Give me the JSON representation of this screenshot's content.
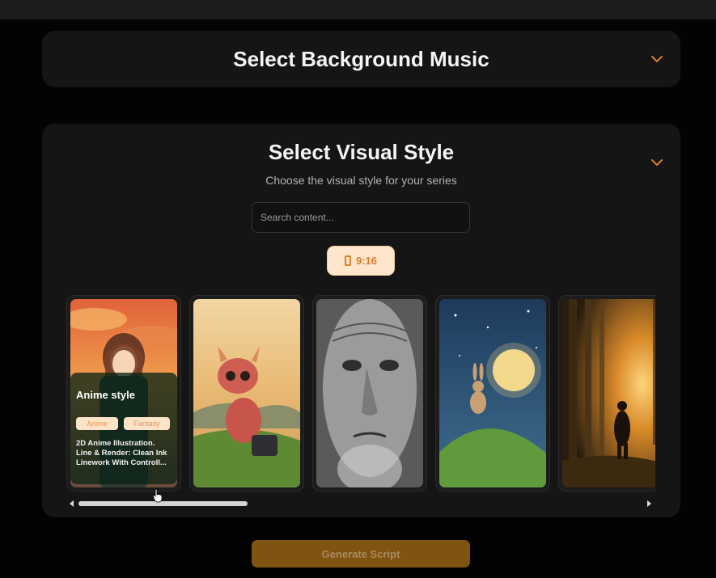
{
  "music_section": {
    "title": "Select Background Music"
  },
  "style_section": {
    "title": "Select Visual Style",
    "subtitle": "Choose the visual style for your  series",
    "search": {
      "placeholder": "Search content..."
    },
    "aspect_ratio": {
      "label": "9:16",
      "icon": "phone-icon"
    },
    "cards": [
      {
        "art": "anime-girl-sunset",
        "title": "Anime style",
        "tags": [
          "Anime",
          "Fantasy"
        ],
        "description": "2D Anime Illustration. Line & Render: Clean Ink Linework With Controll..."
      },
      {
        "art": "cartoon-dragon"
      },
      {
        "art": "pencil-portrait-old-man"
      },
      {
        "art": "rabbit-moon-hill"
      },
      {
        "art": "forest-sunset-samurai"
      }
    ]
  },
  "generate_button": {
    "label": "Generate Script"
  },
  "colors": {
    "accent": "#d8802a",
    "panel": "#151515",
    "background": "#030303",
    "button": "#7f5411"
  }
}
